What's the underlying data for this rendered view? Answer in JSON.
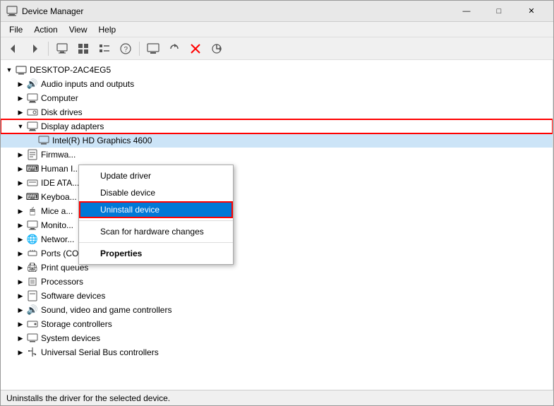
{
  "window": {
    "title": "Device Manager",
    "minimize_btn": "—",
    "maximize_btn": "□",
    "close_btn": "✕"
  },
  "menu": {
    "items": [
      "File",
      "Action",
      "View",
      "Help"
    ]
  },
  "toolbar": {
    "buttons": [
      "◀",
      "▶",
      "🖥",
      "📋",
      "📋",
      "❓",
      "🖥",
      "↕",
      "❌",
      "⬇"
    ]
  },
  "tree": {
    "root": "DESKTOP-2AC4EG5",
    "items": [
      {
        "level": 1,
        "label": "Audio inputs and outputs",
        "icon": "🔊",
        "expanded": false
      },
      {
        "level": 1,
        "label": "Computer",
        "icon": "🖥",
        "expanded": false
      },
      {
        "level": 1,
        "label": "Disk drives",
        "icon": "💾",
        "expanded": false
      },
      {
        "level": 1,
        "label": "Display adapters",
        "icon": "🖥",
        "expanded": true,
        "highlight": true
      },
      {
        "level": 2,
        "label": "Intel(R) HD Graphics 4600",
        "icon": "🖥",
        "selected": true
      },
      {
        "level": 1,
        "label": "Firmware",
        "icon": "📋",
        "expanded": false,
        "truncated": "Firmwa..."
      },
      {
        "level": 1,
        "label": "Human I...",
        "icon": "⌨",
        "expanded": false
      },
      {
        "level": 1,
        "label": "IDE ATA...",
        "icon": "💾",
        "expanded": false
      },
      {
        "level": 1,
        "label": "Keyboa...",
        "icon": "⌨",
        "expanded": false
      },
      {
        "level": 1,
        "label": "Mice a...",
        "icon": "🖱",
        "expanded": false
      },
      {
        "level": 1,
        "label": "Monito...",
        "icon": "🖥",
        "expanded": false
      },
      {
        "level": 1,
        "label": "Networ...",
        "icon": "🌐",
        "expanded": false
      },
      {
        "level": 1,
        "label": "Ports (COM & LPT)",
        "icon": "🔌",
        "expanded": false
      },
      {
        "level": 1,
        "label": "Print queues",
        "icon": "🖨",
        "expanded": false
      },
      {
        "level": 1,
        "label": "Processors",
        "icon": "⚙",
        "expanded": false
      },
      {
        "level": 1,
        "label": "Software devices",
        "icon": "📋",
        "expanded": false
      },
      {
        "level": 1,
        "label": "Sound, video and game controllers",
        "icon": "🔊",
        "expanded": false
      },
      {
        "level": 1,
        "label": "Storage controllers",
        "icon": "💾",
        "expanded": false
      },
      {
        "level": 1,
        "label": "System devices",
        "icon": "🖥",
        "expanded": false
      },
      {
        "level": 1,
        "label": "Universal Serial Bus controllers",
        "icon": "🔌",
        "expanded": false
      }
    ]
  },
  "context_menu": {
    "items": [
      {
        "label": "Update driver",
        "type": "normal"
      },
      {
        "label": "Disable device",
        "type": "normal"
      },
      {
        "label": "Uninstall device",
        "type": "selected"
      },
      {
        "type": "separator"
      },
      {
        "label": "Scan for hardware changes",
        "type": "normal"
      },
      {
        "type": "separator"
      },
      {
        "label": "Properties",
        "type": "bold"
      }
    ]
  },
  "status_bar": {
    "text": "Uninstalls the driver for the selected device."
  }
}
